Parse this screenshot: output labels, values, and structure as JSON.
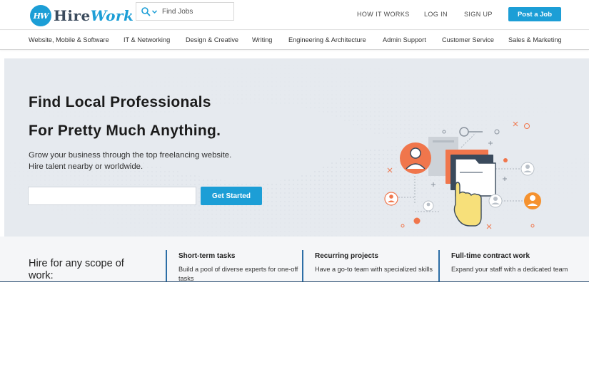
{
  "brand": {
    "logo_badge": "HW",
    "name_part1": "Hire",
    "name_part2": "Work"
  },
  "search": {
    "placeholder": "Find Jobs"
  },
  "topnav": {
    "how_it_works": "HOW IT WORKS",
    "login": "LOG IN",
    "signup": "SIGN UP",
    "post_job": "Post a Job"
  },
  "categories": [
    "Website, Mobile & Software",
    "IT & Networking",
    "Design & Creative",
    "Writing",
    "Engineering & Architecture",
    "Admin Support",
    "Customer Service",
    "Sales & Marketing"
  ],
  "hero": {
    "headline_line1": "Find Local Professionals",
    "headline_line2": "For Pretty Much Anything.",
    "subtext": "Grow your business through the top freelancing website. Hire talent nearby or worldwide.",
    "input_value": "",
    "cta": "Get Started"
  },
  "scope": {
    "title": "Hire for any scope of work:",
    "columns": [
      {
        "title": "Short-term tasks",
        "text": "Build a pool of diverse experts for one-off tasks"
      },
      {
        "title": "Recurring projects",
        "text": "Have a go-to team with specialized skills"
      },
      {
        "title": "Full-time contract work",
        "text": "Expand your staff with a dedicated team"
      }
    ]
  },
  "colors": {
    "accent": "#1c9ed6",
    "hero_bg": "#e6eaef",
    "divider": "#2c6ea6",
    "person_orange": "#f0764c",
    "hand_yellow": "#f7e07a"
  }
}
